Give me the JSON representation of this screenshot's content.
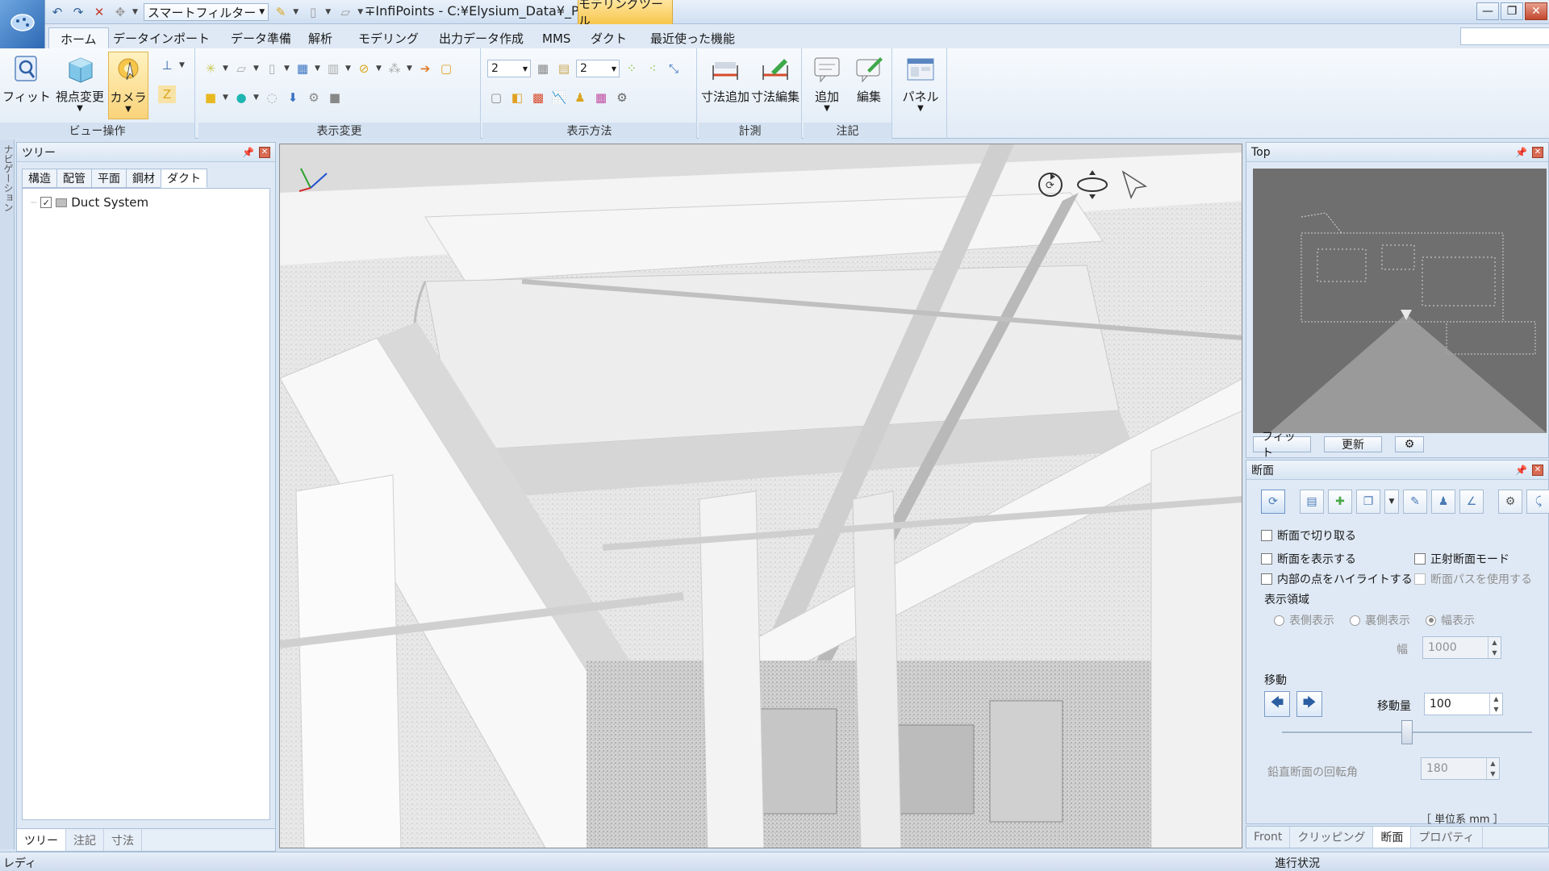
{
  "titlebar": {
    "smart_filter": "スマートフィルター",
    "title": "∓InfiPoints - C:¥Elysium_Data¥_P...",
    "context_tab": "モデリングツール",
    "minimize": "—",
    "maximize": "❐",
    "close": "✕"
  },
  "ribbon_tabs": [
    {
      "label": "ホーム",
      "active": true
    },
    {
      "label": "データインポート"
    },
    {
      "label": "データ準備"
    },
    {
      "label": "解析"
    },
    {
      "label": "モデリング"
    },
    {
      "label": "出力データ作成"
    },
    {
      "label": "MMS"
    },
    {
      "label": "ダクト"
    },
    {
      "label": "最近使った機能"
    }
  ],
  "ribbon": {
    "view_group": {
      "label": "ビュー操作",
      "fit": "フィット",
      "viewpoint": "視点変更",
      "camera": "カメラ"
    },
    "display_change_group": {
      "label": "表示変更"
    },
    "display_method_group": {
      "label": "表示方法",
      "point_size_1": "2",
      "point_size_2": "2"
    },
    "measure_group": {
      "label": "計測",
      "add_dim": "寸法追加",
      "edit_dim": "寸法編集"
    },
    "annotation_group": {
      "label": "注記",
      "add": "追加",
      "edit": "編集"
    },
    "panel_group": {
      "panel": "パネル"
    }
  },
  "nav_strip": {
    "label": "ナビゲーション"
  },
  "tree_panel": {
    "title": "ツリー",
    "tabs": [
      "構造",
      "配管",
      "平面",
      "鋼材",
      "ダクト"
    ],
    "active_tab": "ダクト",
    "node": "Duct System",
    "bottom_tabs": [
      "ツリー",
      "注記",
      "寸法"
    ]
  },
  "top_panel": {
    "title": "Top",
    "fit": "フィット",
    "update": "更新",
    "settings": "⚙"
  },
  "section_panel": {
    "title": "断面",
    "cut_by_section": "断面で切り取る",
    "show_section": "断面を表示する",
    "ortho_mode": "正射断面モード",
    "highlight_inner": "内部の点をハイライトする",
    "use_section_path": "断面パスを使用する",
    "display_area": "表示領域",
    "front_display": "表側表示",
    "back_display": "裏側表示",
    "width_display": "幅表示",
    "width_label": "幅",
    "width_value": "1000",
    "move": "移動",
    "move_amount_label": "移動量",
    "move_amount_value": "100",
    "slider_value": 0.5,
    "rotation_label": "鉛直断面の回転角",
    "rotation_value": "180",
    "units": "［ 単位系 mm ］"
  },
  "right_bottom_tabs": [
    "Front",
    "クリッピング",
    "断面",
    "プロパティ"
  ],
  "right_bottom_active": "断面",
  "status": {
    "left": "レディ",
    "right": "進行状況"
  }
}
